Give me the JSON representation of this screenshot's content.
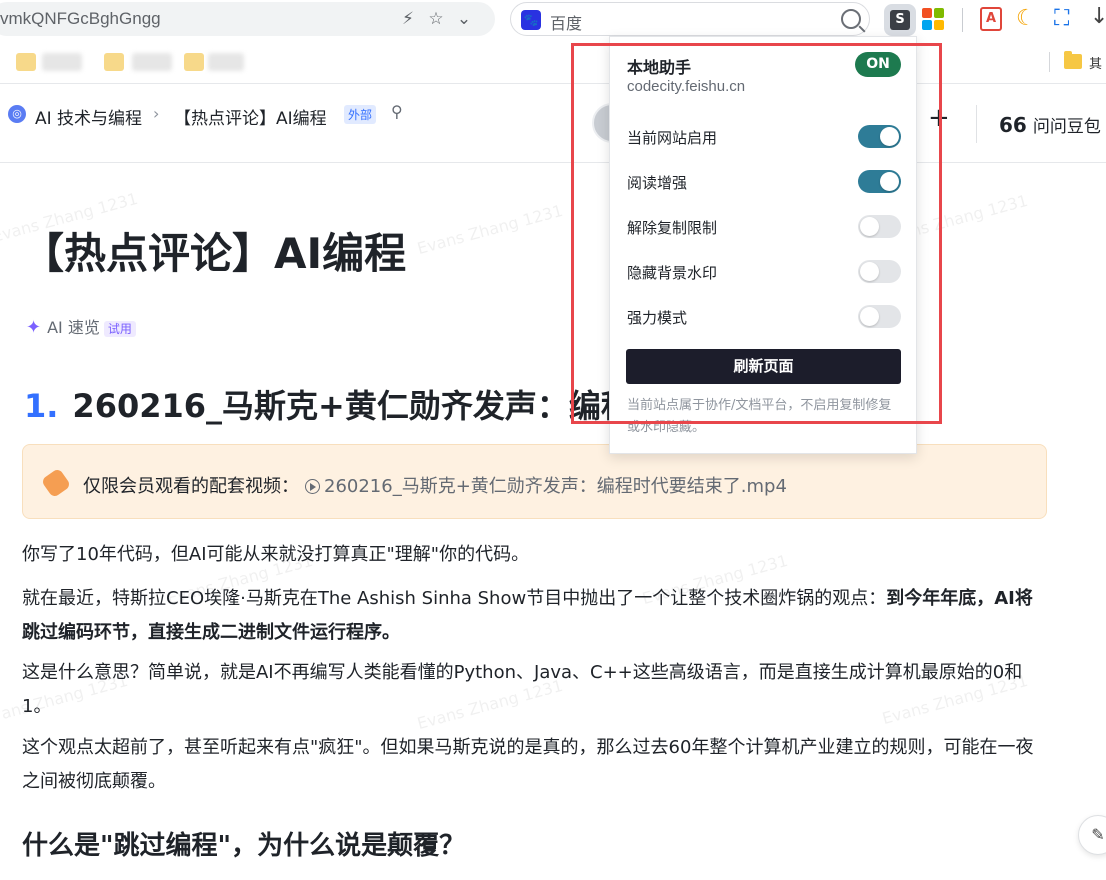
{
  "browser": {
    "url_fragment": "vmkQNFGcBghGngg",
    "search_engine": "百度",
    "extensions": {
      "active": "S",
      "grid_colors": [
        "#f25022",
        "#7fba00",
        "#00a4ef",
        "#ffb900"
      ],
      "pdf": "A"
    },
    "bookmark_folder_label": "其"
  },
  "header": {
    "space": "AI 技术与编程",
    "page": "【热点评论】AI编程",
    "tag": "外部",
    "ask_icon": "66",
    "ask_label": "问问豆包"
  },
  "popup": {
    "title": "本地助手",
    "domain": "codecity.feishu.cn",
    "status": "ON",
    "toggles": [
      {
        "label": "当前网站启用",
        "on": true
      },
      {
        "label": "阅读增强",
        "on": true
      },
      {
        "label": "解除复制限制",
        "on": false
      },
      {
        "label": "隐藏背景水印",
        "on": false
      },
      {
        "label": "强力模式",
        "on": false
      }
    ],
    "refresh_label": "刷新页面",
    "note": "当前站点属于协作/文档平台，不启用复制修复或水印隐藏。"
  },
  "doc": {
    "title": "【热点评论】AI编程",
    "ai_summary": "AI 速览",
    "trial": "试用",
    "h1_number": "1.",
    "h1_text": "260216_马斯克+黄仁勋齐发声：编程",
    "video_prefix": "仅限会员观看的配套视频：",
    "video_link": "260216_马斯克+黄仁勋齐发声：编程时代要结束了.mp4",
    "p1": "你写了10年代码，但AI可能从来就没打算真正\"理解\"你的代码。",
    "p2_plain": "就在最近，特斯拉CEO埃隆·马斯克在The Ashish Sinha Show节目中抛出了一个让整个技术圈炸锅的观点：",
    "p2_bold": "到今年年底，AI将跳过编码环节，直接生成二进制文件运行程序。",
    "p3": "这是什么意思？简单说，就是AI不再编写人类能看懂的Python、Java、C++这些高级语言，而是直接生成计算机最原始的0和1。",
    "p4": "这个观点太超前了，甚至听起来有点\"疯狂\"。但如果马斯克说的是真的，那么过去60年整个计算机产业建立的规则，可能在一夜之间被彻底颠覆。",
    "h2": "什么是\"跳过编程\"，为什么说是颠覆？",
    "watermark": "Evans Zhang 1231"
  }
}
